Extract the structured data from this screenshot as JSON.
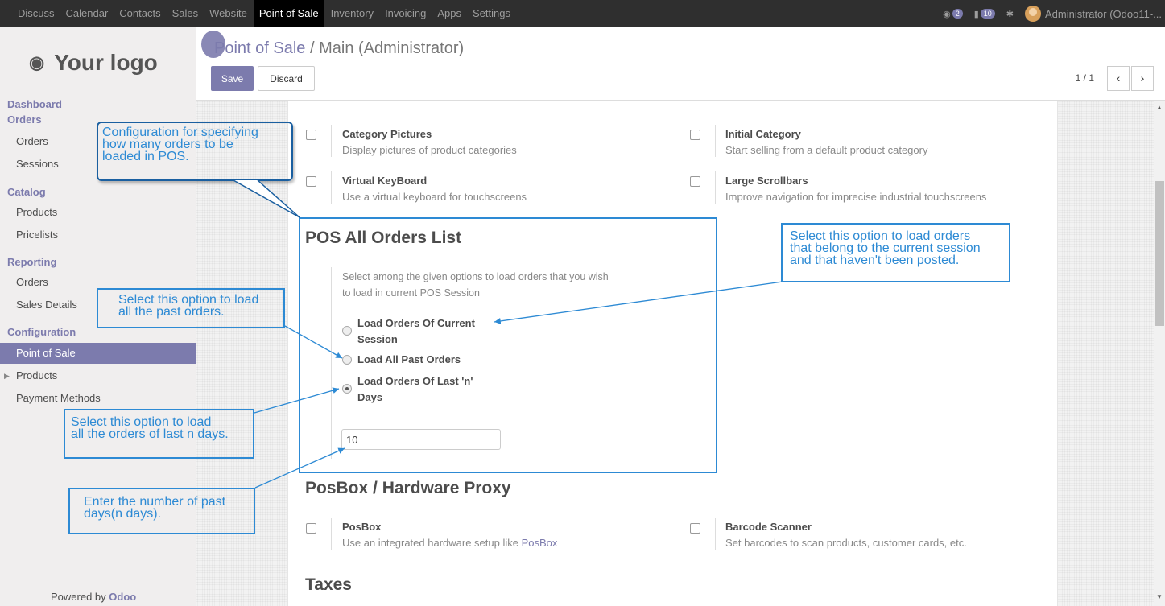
{
  "topnav": {
    "items": [
      "Discuss",
      "Calendar",
      "Contacts",
      "Sales",
      "Website",
      "Point of Sale",
      "Inventory",
      "Invoicing",
      "Apps",
      "Settings"
    ],
    "active": "Point of Sale",
    "chat_badge": "2",
    "messages_badge": "10",
    "user": "Administrator (Odoo11-..."
  },
  "sidebar": {
    "logo": "Your logo",
    "sections": {
      "dashboard": "Dashboard",
      "orders": "Orders",
      "catalog": "Catalog",
      "reporting": "Reporting",
      "configuration": "Configuration"
    },
    "items": {
      "orders": "Orders",
      "sessions": "Sessions",
      "products": "Products",
      "pricelists": "Pricelists",
      "report_orders": "Orders",
      "sales_details": "Sales Details",
      "point_of_sale": "Point of Sale",
      "config_products": "Products",
      "payment_methods": "Payment Methods"
    },
    "powered_by": "Powered by",
    "powered_brand": "Odoo"
  },
  "control": {
    "crumb_link": "Point of Sale",
    "crumb_sep": " / ",
    "crumb_current": "Main (Administrator)",
    "save": "Save",
    "discard": "Discard",
    "pager": "1 / 1"
  },
  "options": {
    "category_pictures": {
      "title": "Category Pictures",
      "desc": "Display pictures of product categories"
    },
    "initial_category": {
      "title": "Initial Category",
      "desc": "Start selling from a default product category"
    },
    "virtual_keyboard": {
      "title": "Virtual KeyBoard",
      "desc": "Use a virtual keyboard for touchscreens"
    },
    "large_scrollbars": {
      "title": "Large Scrollbars",
      "desc": "Improve navigation for imprecise industrial touchscreens"
    },
    "posbox": {
      "title": "PosBox",
      "desc": "Use an integrated hardware setup like ",
      "desc_link": "PosBox"
    },
    "barcode_scanner": {
      "title": "Barcode Scanner",
      "desc": "Set barcodes to scan products, customer cards, etc."
    }
  },
  "orders_list": {
    "title": "POS All Orders List",
    "desc_line1": "Select among the given options to load orders that you wish",
    "desc_line2": "to load in current POS Session",
    "radio_current_1": "Load Orders Of Current",
    "radio_current_2": "Session",
    "radio_all": "Load All Past Orders",
    "radio_last_1": "Load Orders Of Last 'n'",
    "radio_last_2": "Days",
    "selected": "last_n_days",
    "days_value": "10"
  },
  "sections": {
    "posbox": "PosBox / Hardware Proxy",
    "taxes": "Taxes"
  },
  "callouts": {
    "config": [
      "Configuration for specifying",
      "how many orders to be",
      "loaded in POS."
    ],
    "all_past": [
      "Select this option to load",
      "all the past orders."
    ],
    "current_session": [
      "Select this option to load orders",
      "that belong to the current session",
      "and that haven't been posted."
    ],
    "last_n": [
      "Select this option to load",
      "all the orders of last n days."
    ],
    "enter_days": [
      "Enter the number of past",
      "days(n days)."
    ]
  }
}
